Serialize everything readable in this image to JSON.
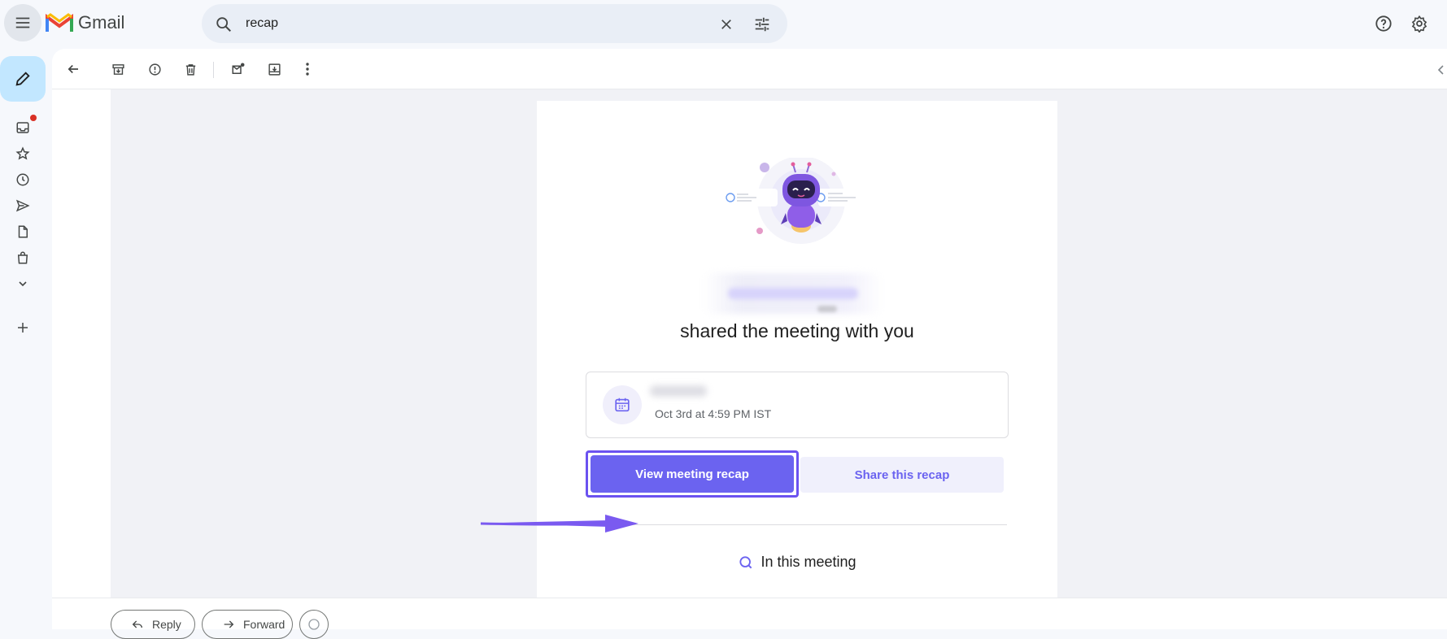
{
  "app": {
    "name": "Gmail"
  },
  "search": {
    "query": "recap"
  },
  "email": {
    "shared_title": "shared the meeting with you",
    "meeting_date": "Oct 3rd at 4:59 PM IST",
    "view_button": "View meeting recap",
    "share_button": "Share this recap",
    "in_meeting": "In this meeting"
  },
  "actions": {
    "reply": "Reply",
    "forward": "Forward"
  },
  "colors": {
    "accent": "#6b63f0",
    "compose": "#c2e7ff",
    "badge": "#d93025"
  },
  "icons": [
    "menu-icon",
    "gmail-logo",
    "search-icon",
    "close-icon",
    "tune-icon",
    "help-icon",
    "gear-icon",
    "pencil-icon",
    "inbox-icon",
    "star-icon",
    "clock-icon",
    "send-icon",
    "draft-icon",
    "bag-icon",
    "chevron-down-icon",
    "plus-icon",
    "back-arrow-icon",
    "archive-icon",
    "report-icon",
    "trash-icon",
    "mark-unread-icon",
    "move-icon",
    "more-icon",
    "calendar-icon",
    "search-small-icon",
    "emoji-icon"
  ]
}
